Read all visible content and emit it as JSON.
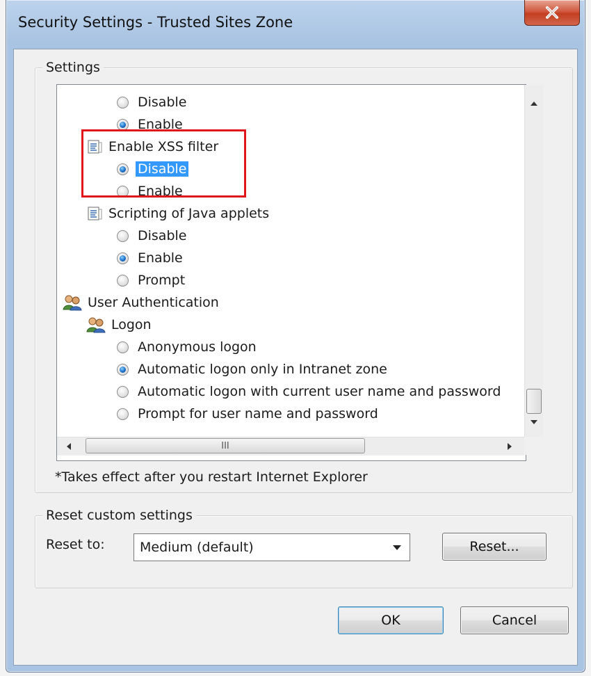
{
  "window": {
    "title": "Security Settings - Trusted Sites Zone",
    "close_label": "X"
  },
  "settings_group": {
    "legend": "Settings",
    "tree": [
      {
        "kind": "radio",
        "label": "Disable",
        "checked": false,
        "level": 2
      },
      {
        "kind": "radio",
        "label": "Enable",
        "checked": true,
        "level": 2
      },
      {
        "kind": "node",
        "icon": "document-settings-icon",
        "label": "Enable XSS filter",
        "level": 1
      },
      {
        "kind": "radio",
        "label": "Disable",
        "checked": true,
        "selected": true,
        "level": 2
      },
      {
        "kind": "radio",
        "label": "Enable",
        "checked": false,
        "level": 2
      },
      {
        "kind": "node",
        "icon": "document-settings-icon",
        "label": "Scripting of Java applets",
        "level": 1
      },
      {
        "kind": "radio",
        "label": "Disable",
        "checked": false,
        "level": 2
      },
      {
        "kind": "radio",
        "label": "Enable",
        "checked": true,
        "level": 2
      },
      {
        "kind": "radio",
        "label": "Prompt",
        "checked": false,
        "level": 2
      },
      {
        "kind": "node",
        "icon": "users-icon",
        "label": "User Authentication",
        "level": 0
      },
      {
        "kind": "node",
        "icon": "users-icon",
        "label": "Logon",
        "level": 1
      },
      {
        "kind": "radio",
        "label": "Anonymous logon",
        "checked": false,
        "level": 2
      },
      {
        "kind": "radio",
        "label": "Automatic logon only in Intranet zone",
        "checked": true,
        "level": 2
      },
      {
        "kind": "radio",
        "label": "Automatic logon with current user name and password",
        "checked": false,
        "level": 2
      },
      {
        "kind": "radio",
        "label": "Prompt for user name and password",
        "checked": false,
        "level": 2
      }
    ],
    "hscroll_thumb_label": "III",
    "note": "*Takes effect after you restart Internet Explorer"
  },
  "reset_group": {
    "legend": "Reset custom settings",
    "reset_to_label": "Reset to:",
    "reset_to_value": "Medium (default)",
    "reset_button": "Reset..."
  },
  "buttons": {
    "ok": "OK",
    "cancel": "Cancel"
  },
  "colors": {
    "selection": "#3399ff",
    "highlight_box": "#e0161a",
    "close_button": "#c33e20"
  }
}
